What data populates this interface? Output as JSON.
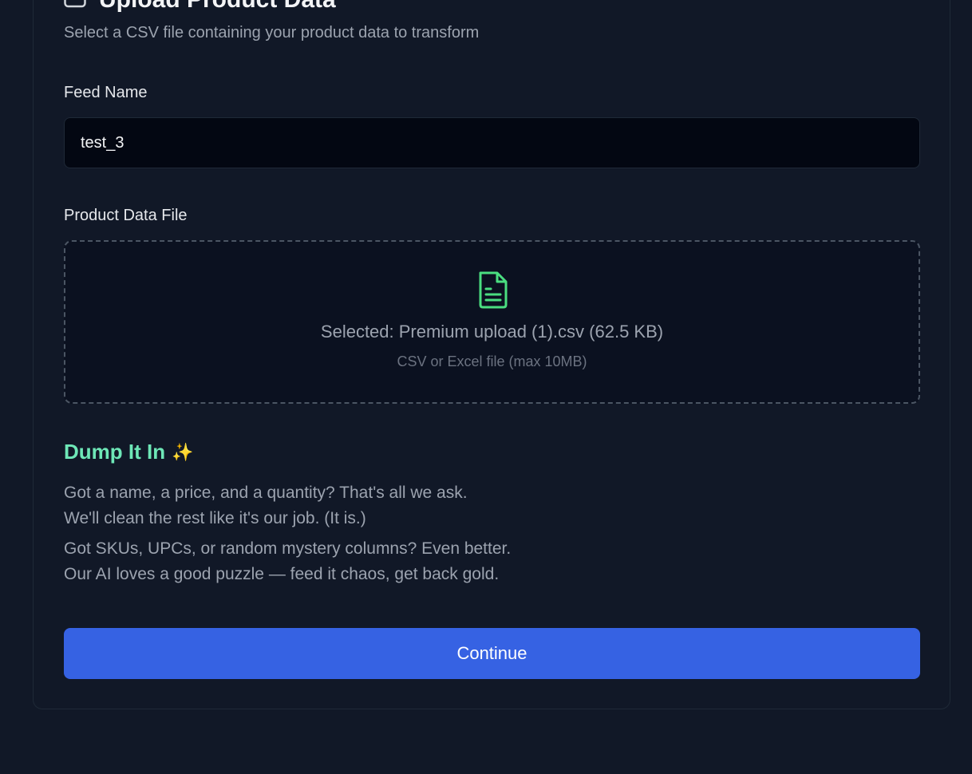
{
  "header": {
    "title": "Upload Product Data",
    "title_icon": "upload-box-icon",
    "subtitle": "Select a CSV file containing your product data to transform"
  },
  "form": {
    "feed_name_label": "Feed Name",
    "feed_name_value": "test_3",
    "file_label": "Product Data File",
    "dropzone": {
      "icon": "file-text-icon",
      "selected_text": "Selected: Premium upload (1).csv (62.5 KB)",
      "hint_text": "CSV or Excel file (max 10MB)"
    }
  },
  "info": {
    "heading": "Dump It In",
    "heading_emoji": "✨",
    "line1": "Got a name, a price, and a quantity? That's all we ask.",
    "line2": "We'll clean the rest like it's our job. (It is.)",
    "line3": "Got SKUs, UPCs, or random mystery columns? Even better.",
    "line4": "Our AI loves a good puzzle — feed it chaos, get back gold."
  },
  "actions": {
    "continue_label": "Continue"
  },
  "colors": {
    "background": "#111827",
    "accent_button": "#3662e3",
    "success_icon": "#4ade80",
    "heading_green": "#6ee7b7"
  }
}
